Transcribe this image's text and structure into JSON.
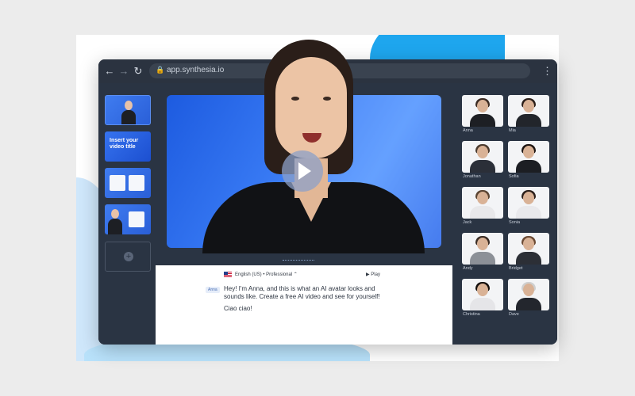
{
  "browser": {
    "url": "app.synthesia.io",
    "back_icon": "←",
    "forward_icon": "→",
    "reload_icon": "↻",
    "menu_icon": "⋮",
    "lock_icon": "🔒"
  },
  "slides": {
    "slide2_title": "Insert your video title",
    "add_icon": "+"
  },
  "editor": {
    "voice_label": "English (US) • Professional ⌃",
    "play_label": "▶ Play",
    "speaker_tag": "Anna",
    "script": "Hey! I'm Anna, and this is what an AI avatar looks and sounds like. Create a free AI video and see for yourself!",
    "sign_off": "Ciao ciao!"
  },
  "avatars": {
    "items": [
      {
        "name": "Anna",
        "hair": "#3a2a22",
        "top": "#1d1f24"
      },
      {
        "name": "Mia",
        "hair": "#2a1e19",
        "top": "#22252b"
      },
      {
        "name": "Jonathan",
        "hair": "#4a3a2e",
        "top": "#2b2f38"
      },
      {
        "name": "Sofia",
        "hair": "#1d1512",
        "top": "#1c1e23"
      },
      {
        "name": "Jack",
        "hair": "#5a4432",
        "top": "#e8e8ea"
      },
      {
        "name": "Sonia",
        "hair": "#2a1e19",
        "top": "#e9e9ec"
      },
      {
        "name": "Andy",
        "hair": "#3a2c24",
        "top": "#8c9097"
      },
      {
        "name": "Bridget",
        "hair": "#6b4a34",
        "top": "#2c2f36"
      },
      {
        "name": "Christina",
        "hair": "#140f0d",
        "top": "#e5e5e8"
      },
      {
        "name": "Dave",
        "hair": "#cfcfcf",
        "top": "#23262d"
      }
    ]
  },
  "colors": {
    "accent": "#1ea6ee",
    "preview_blue": "#2b63e6",
    "panel": "#2a3443"
  }
}
